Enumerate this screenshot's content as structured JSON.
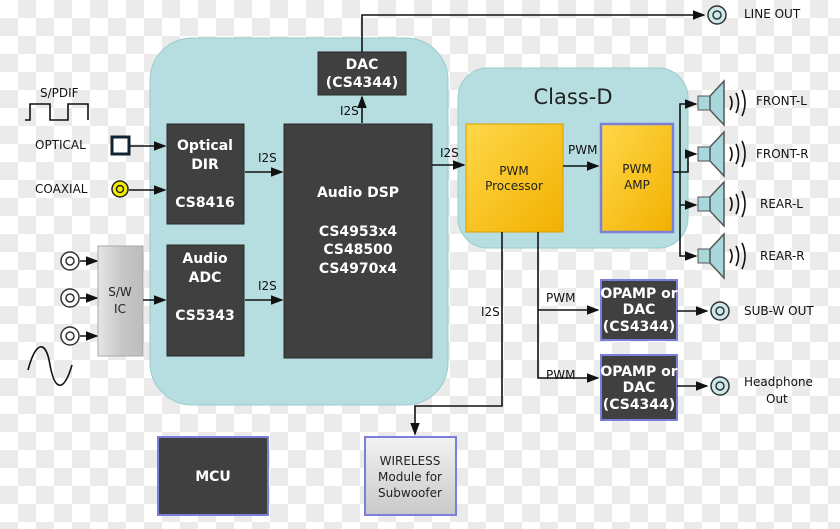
{
  "colors": {
    "panel": "#b6dde0",
    "chip": "#404040",
    "pwm": "#fbbf0a",
    "jack_yellow": "#f5f000",
    "speaker": "#a8d8dc"
  },
  "inputs": {
    "spdif": "S/PDIF",
    "optical": "OPTICAL",
    "coaxial": "COAXIAL"
  },
  "blocks": {
    "dac": [
      "DAC",
      "(CS4344)"
    ],
    "optical_dir": [
      "Optical",
      "DIR",
      "CS8416"
    ],
    "audio_adc": [
      "Audio",
      "ADC",
      "CS5343"
    ],
    "sw_ic": [
      "S/W",
      "IC"
    ],
    "audio_dsp": [
      "Audio DSP",
      "CS4953x4",
      "CS48500",
      "CS4970x4"
    ],
    "class_d": "Class-D",
    "pwm_processor": [
      "PWM",
      "Processor"
    ],
    "pwm_amp": [
      "PWM",
      "AMP"
    ],
    "opamp1": [
      "OPAMP or",
      "DAC",
      "(CS4344)"
    ],
    "opamp2": [
      "OPAMP or",
      "DAC",
      "(CS4344)"
    ],
    "mcu": "MCU",
    "wireless": [
      "WIRELESS",
      "Module for",
      "Subwoofer"
    ]
  },
  "signals": {
    "i2s": "I2S",
    "pwm": "PWM"
  },
  "outputs": {
    "line_out": "LINE OUT",
    "front_l": "FRONT-L",
    "front_r": "FRONT-R",
    "rear_l": "REAR-L",
    "rear_r": "REAR-R",
    "sub_w": "SUB-W OUT",
    "headphone": [
      "Headphone",
      "Out"
    ]
  }
}
